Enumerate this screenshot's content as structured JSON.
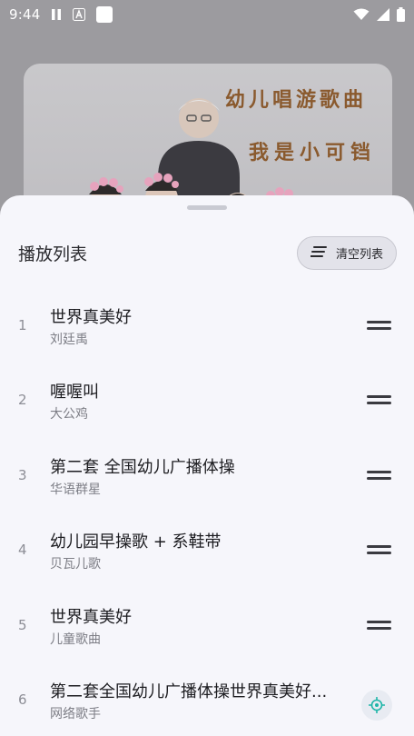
{
  "status_bar": {
    "time": "9:44"
  },
  "background": {
    "banner_line_1": "幼儿唱游歌曲",
    "banner_line_2": "我是小可铛"
  },
  "sheet": {
    "title": "播放列表",
    "clear_button_label": "清空列表",
    "items": [
      {
        "index": "1",
        "title": "世界真美好",
        "artist": "刘廷禹"
      },
      {
        "index": "2",
        "title": "喔喔叫",
        "artist": "大公鸡"
      },
      {
        "index": "3",
        "title": "第二套 全国幼儿广播体操",
        "artist": "华语群星"
      },
      {
        "index": "4",
        "title": "幼儿园早操歌 + 系鞋带",
        "artist": "贝瓦儿歌"
      },
      {
        "index": "5",
        "title": "世界真美好",
        "artist": "儿童歌曲"
      },
      {
        "index": "6",
        "title": "第二套全国幼儿广播体操世界真美好...",
        "artist": "网络歌手"
      }
    ]
  },
  "colors": {
    "sheet_bg": "#f6f6fb",
    "accent": "#1fb5a8"
  },
  "icons": {
    "clear": "list-clear-icon",
    "drag": "drag-handle-icon",
    "locate": "locate-icon"
  }
}
